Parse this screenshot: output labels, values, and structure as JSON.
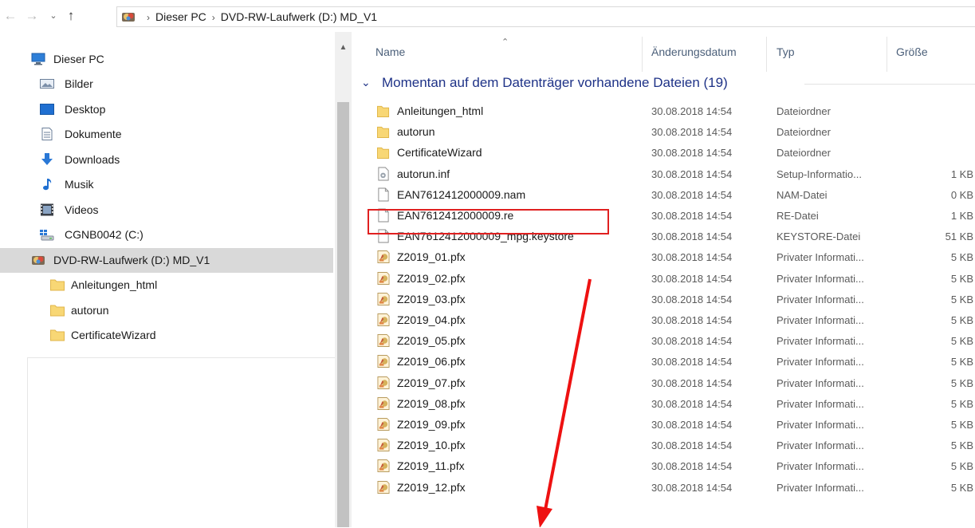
{
  "address": {
    "back_icon": "arrow-left-icon",
    "forward_icon": "arrow-right-icon",
    "recent_icon": "chevron-down-icon",
    "up_icon": "arrow-up-icon",
    "crumbs": [
      "Dieser PC",
      "DVD-RW-Laufwerk (D:) MD_V1"
    ]
  },
  "nav": {
    "items": [
      {
        "label": "Dieser PC",
        "icon": "computer-icon"
      },
      {
        "label": "Bilder",
        "icon": "pictures-icon"
      },
      {
        "label": "Desktop",
        "icon": "desktop-icon"
      },
      {
        "label": "Dokumente",
        "icon": "documents-icon"
      },
      {
        "label": "Downloads",
        "icon": "downloads-icon"
      },
      {
        "label": "Musik",
        "icon": "music-icon"
      },
      {
        "label": "Videos",
        "icon": "videos-icon"
      },
      {
        "label": "CGNB0042 (C:)",
        "icon": "drive-icon"
      },
      {
        "label": "DVD-RW-Laufwerk (D:) MD_V1",
        "icon": "dvd-drive-icon",
        "selected": true
      },
      {
        "label": "Anleitungen_html",
        "icon": "folder-icon"
      },
      {
        "label": "autorun",
        "icon": "folder-icon"
      },
      {
        "label": "CertificateWizard",
        "icon": "folder-icon"
      }
    ]
  },
  "columns": {
    "name": "Name",
    "date": "Änderungsdatum",
    "type": "Typ",
    "size": "Größe"
  },
  "group": {
    "label": "Momentan auf dem Datenträger vorhandene Dateien (19)"
  },
  "files": [
    {
      "name": "Anleitungen_html",
      "date": "30.08.2018 14:54",
      "type": "Dateiordner",
      "size": "",
      "icon": "folder-icon"
    },
    {
      "name": "autorun",
      "date": "30.08.2018 14:54",
      "type": "Dateiordner",
      "size": "",
      "icon": "folder-icon"
    },
    {
      "name": "CertificateWizard",
      "date": "30.08.2018 14:54",
      "type": "Dateiordner",
      "size": "",
      "icon": "folder-icon"
    },
    {
      "name": "autorun.inf",
      "date": "30.08.2018 14:54",
      "type": "Setup-Informatio...",
      "size": "1 KB",
      "icon": "setup-file-icon"
    },
    {
      "name": "EAN7612412000009.nam",
      "date": "30.08.2018 14:54",
      "type": "NAM-Datei",
      "size": "0 KB",
      "icon": "file-icon"
    },
    {
      "name": "EAN7612412000009.re",
      "date": "30.08.2018 14:54",
      "type": "RE-Datei",
      "size": "1 KB",
      "icon": "file-icon"
    },
    {
      "name": "EAN7612412000009_mpg.keystore",
      "date": "30.08.2018 14:54",
      "type": "KEYSTORE-Datei",
      "size": "51 KB",
      "icon": "file-icon",
      "highlighted": true
    },
    {
      "name": "Z2019_01.pfx",
      "date": "30.08.2018 14:54",
      "type": "Privater Informati...",
      "size": "5 KB",
      "icon": "certificate-icon"
    },
    {
      "name": "Z2019_02.pfx",
      "date": "30.08.2018 14:54",
      "type": "Privater Informati...",
      "size": "5 KB",
      "icon": "certificate-icon"
    },
    {
      "name": "Z2019_03.pfx",
      "date": "30.08.2018 14:54",
      "type": "Privater Informati...",
      "size": "5 KB",
      "icon": "certificate-icon"
    },
    {
      "name": "Z2019_04.pfx",
      "date": "30.08.2018 14:54",
      "type": "Privater Informati...",
      "size": "5 KB",
      "icon": "certificate-icon"
    },
    {
      "name": "Z2019_05.pfx",
      "date": "30.08.2018 14:54",
      "type": "Privater Informati...",
      "size": "5 KB",
      "icon": "certificate-icon"
    },
    {
      "name": "Z2019_06.pfx",
      "date": "30.08.2018 14:54",
      "type": "Privater Informati...",
      "size": "5 KB",
      "icon": "certificate-icon"
    },
    {
      "name": "Z2019_07.pfx",
      "date": "30.08.2018 14:54",
      "type": "Privater Informati...",
      "size": "5 KB",
      "icon": "certificate-icon"
    },
    {
      "name": "Z2019_08.pfx",
      "date": "30.08.2018 14:54",
      "type": "Privater Informati...",
      "size": "5 KB",
      "icon": "certificate-icon"
    },
    {
      "name": "Z2019_09.pfx",
      "date": "30.08.2018 14:54",
      "type": "Privater Informati...",
      "size": "5 KB",
      "icon": "certificate-icon"
    },
    {
      "name": "Z2019_10.pfx",
      "date": "30.08.2018 14:54",
      "type": "Privater Informati...",
      "size": "5 KB",
      "icon": "certificate-icon"
    },
    {
      "name": "Z2019_11.pfx",
      "date": "30.08.2018 14:54",
      "type": "Privater Informati...",
      "size": "5 KB",
      "icon": "certificate-icon"
    },
    {
      "name": "Z2019_12.pfx",
      "date": "30.08.2018 14:54",
      "type": "Privater Informati...",
      "size": "5 KB",
      "icon": "certificate-icon"
    }
  ],
  "colors": {
    "group_header": "#1e3287",
    "column_header": "#4c607a",
    "highlight_box": "#e02020",
    "annotation_arrow": "#ee1111",
    "selected_nav": "#d9d9d9"
  }
}
